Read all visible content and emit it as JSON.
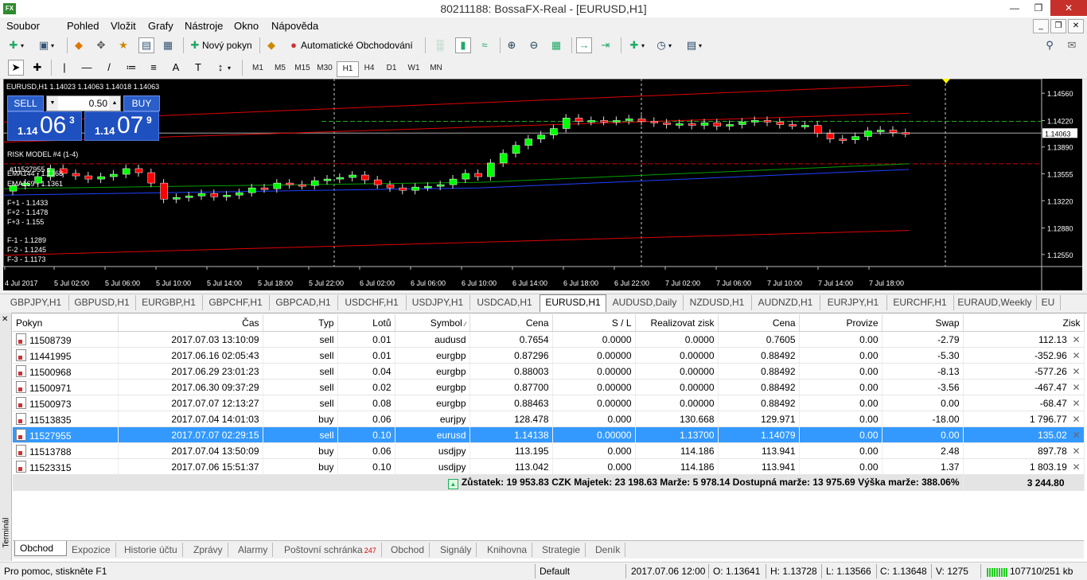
{
  "window": {
    "title": "80211188: BossaFX-Real - [EURUSD,H1]",
    "app_icon": "FX"
  },
  "menu": [
    "Soubor",
    "Pohled",
    "Vložit",
    "Grafy",
    "Nástroje",
    "Okno",
    "Nápověda"
  ],
  "toolbar": {
    "new_order": "Nový pokyn",
    "auto_trading": "Automatické Obchodování"
  },
  "timeframes": [
    "M1",
    "M5",
    "M15",
    "M30",
    "H1",
    "H4",
    "D1",
    "W1",
    "MN"
  ],
  "active_timeframe": "H1",
  "chart": {
    "ticker": "EURUSD,H1  1.14023 1.14063 1.14018 1.14063",
    "sell_label": "SELL",
    "buy_label": "BUY",
    "lot": "0.50",
    "sell_pre": "1.14",
    "sell_big": "06",
    "sell_sup": "3",
    "buy_pre": "1.14",
    "buy_big": "07",
    "buy_sup": "9",
    "indicators": {
      "model": "RISK MODEL #4 (1-4)",
      "ticket": "#11527955 s",
      "ema144": "EMA144 - 1.1368",
      "ema169": "EMA169 - 1.1361",
      "fp1": "F+1 - 1.1433",
      "fp2": "F+2 - 1.1478",
      "fp3": "F+3 - 1.155",
      "fm1": "F-1 - 1.1289",
      "fm2": "F-2 - 1.1245",
      "fm3": "F-3 - 1.1173"
    },
    "current_price": "1.14063",
    "price_ticks": [
      "1.14560",
      "1.14220",
      "1.13890",
      "1.13555",
      "1.13220",
      "1.12880",
      "1.12550"
    ],
    "time_ticks": [
      "4 Jul 2017",
      "5 Jul 02:00",
      "5 Jul 06:00",
      "5 Jul 10:00",
      "5 Jul 14:00",
      "5 Jul 18:00",
      "5 Jul 22:00",
      "6 Jul 02:00",
      "6 Jul 06:00",
      "6 Jul 10:00",
      "6 Jul 14:00",
      "6 Jul 18:00",
      "6 Jul 22:00",
      "7 Jul 02:00",
      "7 Jul 06:00",
      "7 Jul 10:00",
      "7 Jul 14:00",
      "7 Jul 18:00"
    ],
    "colors": {
      "bull": "#00ff00",
      "bear": "#ff0000",
      "ema144": "#00a000",
      "ema169": "#2040ff",
      "channel": "#e00000"
    }
  },
  "chart_tabs": [
    "GBPJPY,H1",
    "GBPUSD,H1",
    "EURGBP,H1",
    "GBPCHF,H1",
    "GBPCAD,H1",
    "USDCHF,H1",
    "USDJPY,H1",
    "USDCAD,H1",
    "EURUSD,H1",
    "AUDUSD,Daily",
    "NZDUSD,H1",
    "AUDNZD,H1",
    "EURJPY,H1",
    "EURCHF,H1",
    "EURAUD,Weekly",
    "EU"
  ],
  "active_chart_tab": "EURUSD,H1",
  "terminal": {
    "side_label": "Terminál",
    "columns": [
      "Pokyn",
      "Čas",
      "Typ",
      "Lotů",
      "Symbol",
      "Cena",
      "S / L",
      "Realizovat zisk",
      "Cena",
      "Provize",
      "Swap",
      "Zisk"
    ],
    "rows": [
      {
        "ticket": "11508739",
        "time": "2017.07.03 13:10:09",
        "type": "sell",
        "lots": "0.01",
        "symbol": "audusd",
        "price": "0.7654",
        "sl": "0.0000",
        "tp": "0.0000",
        "cur": "0.7605",
        "comm": "0.00",
        "swap": "-2.79",
        "profit": "112.13"
      },
      {
        "ticket": "11441995",
        "time": "2017.06.16 02:05:43",
        "type": "sell",
        "lots": "0.01",
        "symbol": "eurgbp",
        "price": "0.87296",
        "sl": "0.00000",
        "tp": "0.00000",
        "cur": "0.88492",
        "comm": "0.00",
        "swap": "-5.30",
        "profit": "-352.96"
      },
      {
        "ticket": "11500968",
        "time": "2017.06.29 23:01:23",
        "type": "sell",
        "lots": "0.04",
        "symbol": "eurgbp",
        "price": "0.88003",
        "sl": "0.00000",
        "tp": "0.00000",
        "cur": "0.88492",
        "comm": "0.00",
        "swap": "-8.13",
        "profit": "-577.26"
      },
      {
        "ticket": "11500971",
        "time": "2017.06.30 09:37:29",
        "type": "sell",
        "lots": "0.02",
        "symbol": "eurgbp",
        "price": "0.87700",
        "sl": "0.00000",
        "tp": "0.00000",
        "cur": "0.88492",
        "comm": "0.00",
        "swap": "-3.56",
        "profit": "-467.47"
      },
      {
        "ticket": "11500973",
        "time": "2017.07.07 12:13:27",
        "type": "sell",
        "lots": "0.08",
        "symbol": "eurgbp",
        "price": "0.88463",
        "sl": "0.00000",
        "tp": "0.00000",
        "cur": "0.88492",
        "comm": "0.00",
        "swap": "0.00",
        "profit": "-68.47"
      },
      {
        "ticket": "11513835",
        "time": "2017.07.04 14:01:03",
        "type": "buy",
        "lots": "0.06",
        "symbol": "eurjpy",
        "price": "128.478",
        "sl": "0.000",
        "tp": "130.668",
        "cur": "129.971",
        "comm": "0.00",
        "swap": "-18.00",
        "profit": "1 796.77"
      },
      {
        "ticket": "11527955",
        "time": "2017.07.07 02:29:15",
        "type": "sell",
        "lots": "0.10",
        "symbol": "eurusd",
        "price": "1.14138",
        "sl": "0.00000",
        "tp": "1.13700",
        "cur": "1.14079",
        "comm": "0.00",
        "swap": "0.00",
        "profit": "135.02",
        "selected": true
      },
      {
        "ticket": "11513788",
        "time": "2017.07.04 13:50:09",
        "type": "buy",
        "lots": "0.06",
        "symbol": "usdjpy",
        "price": "113.195",
        "sl": "0.000",
        "tp": "114.186",
        "cur": "113.941",
        "comm": "0.00",
        "swap": "2.48",
        "profit": "897.78"
      },
      {
        "ticket": "11523315",
        "time": "2017.07.06 15:51:37",
        "type": "buy",
        "lots": "0.10",
        "symbol": "usdjpy",
        "price": "113.042",
        "sl": "0.000",
        "tp": "114.186",
        "cur": "113.941",
        "comm": "0.00",
        "swap": "1.37",
        "profit": "1 803.19"
      }
    ],
    "summary": "Zůstatek: 19 953.83 CZK  Majetek: 23 198.63  Marže: 5 978.14  Dostupná marže: 13 975.69  Výška marže: 388.06%",
    "summary_total": "3 244.80"
  },
  "bottom_tabs": [
    {
      "label": "Obchod",
      "active": true
    },
    {
      "label": "Expozice"
    },
    {
      "label": "Historie účtu"
    },
    {
      "label": "Zprávy"
    },
    {
      "label": "Alarmy"
    },
    {
      "label": "Poštovní schránka",
      "badge": "247"
    },
    {
      "label": "Obchod"
    },
    {
      "label": "Signály"
    },
    {
      "label": "Knihovna"
    },
    {
      "label": "Strategie"
    },
    {
      "label": "Deník"
    }
  ],
  "status": {
    "help": "Pro pomoc, stiskněte F1",
    "profile": "Default",
    "datetime": "2017.07.06 12:00",
    "open": "O: 1.13641",
    "high": "H: 1.13728",
    "low": "L: 1.13566",
    "close": "C: 1.13648",
    "volume": "V: 1275",
    "traffic": "107710/251 kb"
  }
}
